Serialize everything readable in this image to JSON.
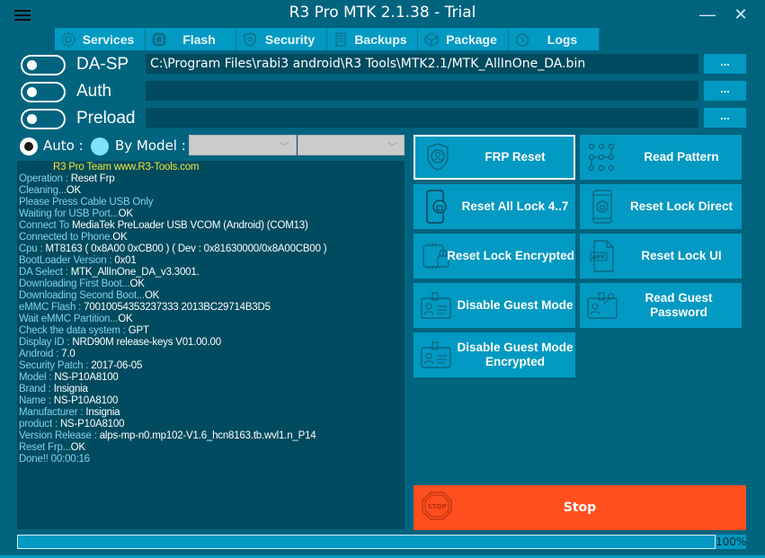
{
  "window": {
    "title": "R3 Pro MTK 2.1.38 - Trial",
    "minimize_glyph": "—",
    "close_glyph": "✕"
  },
  "tabs": [
    {
      "label": "Services",
      "icon": "gear-icon"
    },
    {
      "label": "Flash",
      "icon": "chip-icon"
    },
    {
      "label": "Security",
      "icon": "shield-icon"
    },
    {
      "label": "Backups",
      "icon": "floppy-icon"
    },
    {
      "label": "Package",
      "icon": "box-icon"
    },
    {
      "label": "Logs",
      "icon": "clock-icon"
    }
  ],
  "files": [
    {
      "label": "DA-SP",
      "enabled": false,
      "path": "C:\\Program Files\\rabi3 android\\R3 Tools\\MTK2.1/MTK_AllInOne_DA.bin",
      "browse_label": "..."
    },
    {
      "label": "Auth",
      "enabled": false,
      "path": "",
      "browse_label": "..."
    },
    {
      "label": "Preload",
      "enabled": false,
      "path": "",
      "browse_label": "..."
    }
  ],
  "mode": {
    "auto_label": "Auto :",
    "by_model_label": "By Model :",
    "selected": "auto",
    "brand_select_value": "",
    "model_select_value": "",
    "chevron_glyph": "﹀"
  },
  "log": {
    "header": "R3 Pro Team www.R3-Tools.com",
    "lines": [
      {
        "k": "Operation : ",
        "v": "Reset Frp"
      },
      {
        "k": "Cleaning...",
        "v": "OK"
      },
      {
        "k": "Please Press Cable USB Only",
        "v": ""
      },
      {
        "k": "Waiting for USB Port...",
        "v": "OK"
      },
      {
        "k": "Connect To ",
        "v": "MediaTek PreLoader USB VCOM (Android) (COM13)"
      },
      {
        "k": "Connected to Phone.",
        "v": "OK"
      },
      {
        "k": "Cpu : ",
        "v": "MT8163 ( 0x8A00  0xCB00 ) ( Dev : 0x81630000/0x8A00CB00 )"
      },
      {
        "k": "BootLoader Version : ",
        "v": "0x01"
      },
      {
        "k": "DA Select : ",
        "v": "MTK_AllInOne_DA_v3.3001."
      },
      {
        "k": "Downloading First Boot...",
        "v": "OK"
      },
      {
        "k": "Downloading Second Boot...",
        "v": "OK"
      },
      {
        "k": "eMMC Flash : ",
        "v": "70010054353237333 2013BC29714B3D5"
      },
      {
        "k": "Wait eMMC Partition...",
        "v": "OK"
      },
      {
        "k": "Check the data system : ",
        "v": "GPT"
      },
      {
        "k": "Display ID : ",
        "v": "NRD90M release-keys V01.00.00"
      },
      {
        "k": "Android : ",
        "v": "7.0"
      },
      {
        "k": "Security Patch : ",
        "v": "2017-06-05"
      },
      {
        "k": "Model : ",
        "v": "NS-P10A8100"
      },
      {
        "k": "Brand : ",
        "v": "Insignia"
      },
      {
        "k": "Name : ",
        "v": "NS-P10A8100"
      },
      {
        "k": "Manufacturer : ",
        "v": "Insignia"
      },
      {
        "k": "product : ",
        "v": "NS-P10A8100"
      },
      {
        "k": "Version Release : ",
        "v": "alps-mp-n0.mp102-V1.6_hcn8163.tb.wvl1.n_P14"
      },
      {
        "k": "Reset Frp...",
        "v": "OK"
      },
      {
        "k": "Done!! 00:00:16",
        "v": ""
      }
    ]
  },
  "actions": [
    {
      "label": "FRP Reset",
      "icon": "shield-user-icon",
      "selected": true
    },
    {
      "label": "Read Pattern",
      "icon": "pattern-icon",
      "selected": false
    },
    {
      "label": "Reset All Lock 4..7",
      "icon": "phone-unlock-icon",
      "selected": false
    },
    {
      "label": "Reset Lock Direct",
      "icon": "phone-lock-refresh-icon",
      "selected": false
    },
    {
      "label": "Reset Lock Encrypted",
      "icon": "chip-lock-icon",
      "selected": false
    },
    {
      "label": "Reset Lock UI",
      "icon": "apk-file-icon",
      "selected": false
    },
    {
      "label": "Disable Guest Mode",
      "icon": "id-card-icon",
      "selected": false
    },
    {
      "label": "Read Guest Password",
      "icon": "id-card-key-icon",
      "selected": false
    },
    {
      "label": "Disable Guest Mode Encrypted",
      "icon": "id-card-icon",
      "selected": false
    }
  ],
  "stop": {
    "label": "Stop",
    "icon_text": "STOP"
  },
  "progress": {
    "percent": 100,
    "text": "100%"
  },
  "colors": {
    "background": "#01647f",
    "accent": "#0299c2",
    "panel": "#004b5f",
    "stop": "#ff4f1e",
    "log_header": "#f0e63c",
    "log_key": "#7fd4ea"
  }
}
